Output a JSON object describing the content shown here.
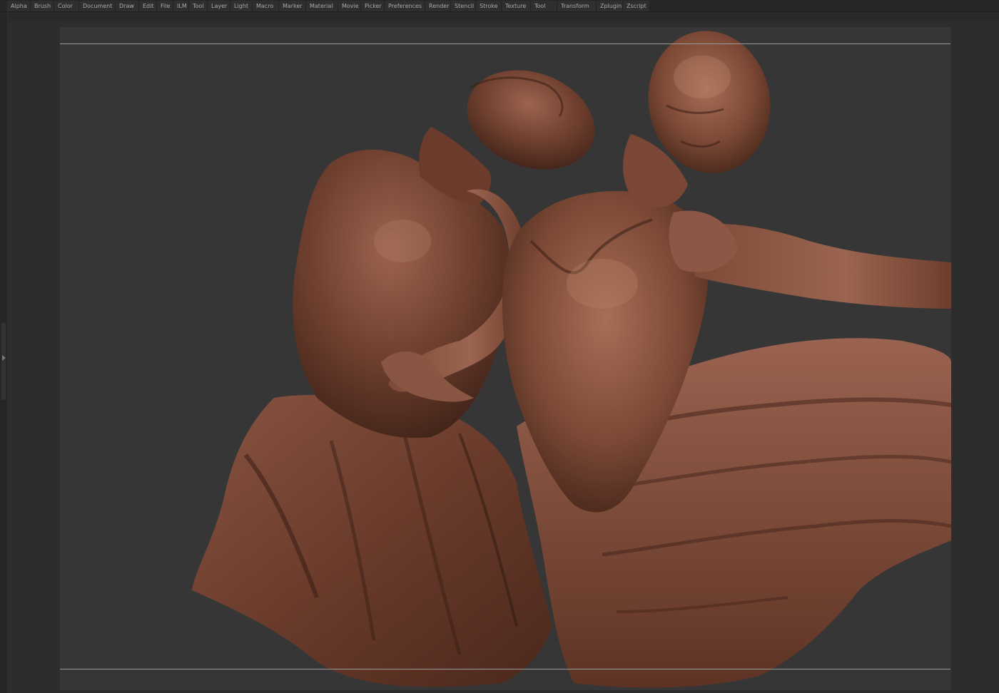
{
  "menubar": {
    "items": [
      {
        "label": "Alpha"
      },
      {
        "label": "Brush"
      },
      {
        "label": "Color"
      },
      {
        "label": "Document"
      },
      {
        "label": "Draw"
      },
      {
        "label": "Edit"
      },
      {
        "label": "File"
      },
      {
        "label": "ILM"
      },
      {
        "label": "Tool"
      },
      {
        "label": "Layer"
      },
      {
        "label": "Light"
      },
      {
        "label": "Macro"
      },
      {
        "label": "Marker"
      },
      {
        "label": "Material"
      },
      {
        "label": "Movie"
      },
      {
        "label": "Picker"
      },
      {
        "label": "Preferences"
      },
      {
        "label": "Render"
      },
      {
        "label": "Stencil"
      },
      {
        "label": "Stroke"
      },
      {
        "label": "Texture"
      },
      {
        "label": "Tool"
      },
      {
        "label": "Transform"
      },
      {
        "label": "Zplugin"
      },
      {
        "label": "Zscript"
      }
    ]
  },
  "colors": {
    "background": "#2a2a2a",
    "document": "#363636",
    "clay_dark": "#4a2a1e",
    "clay_mid": "#7a4a36",
    "clay_light": "#a87058"
  },
  "icons": {
    "tray_toggle": "triangle-arrow-icon"
  }
}
